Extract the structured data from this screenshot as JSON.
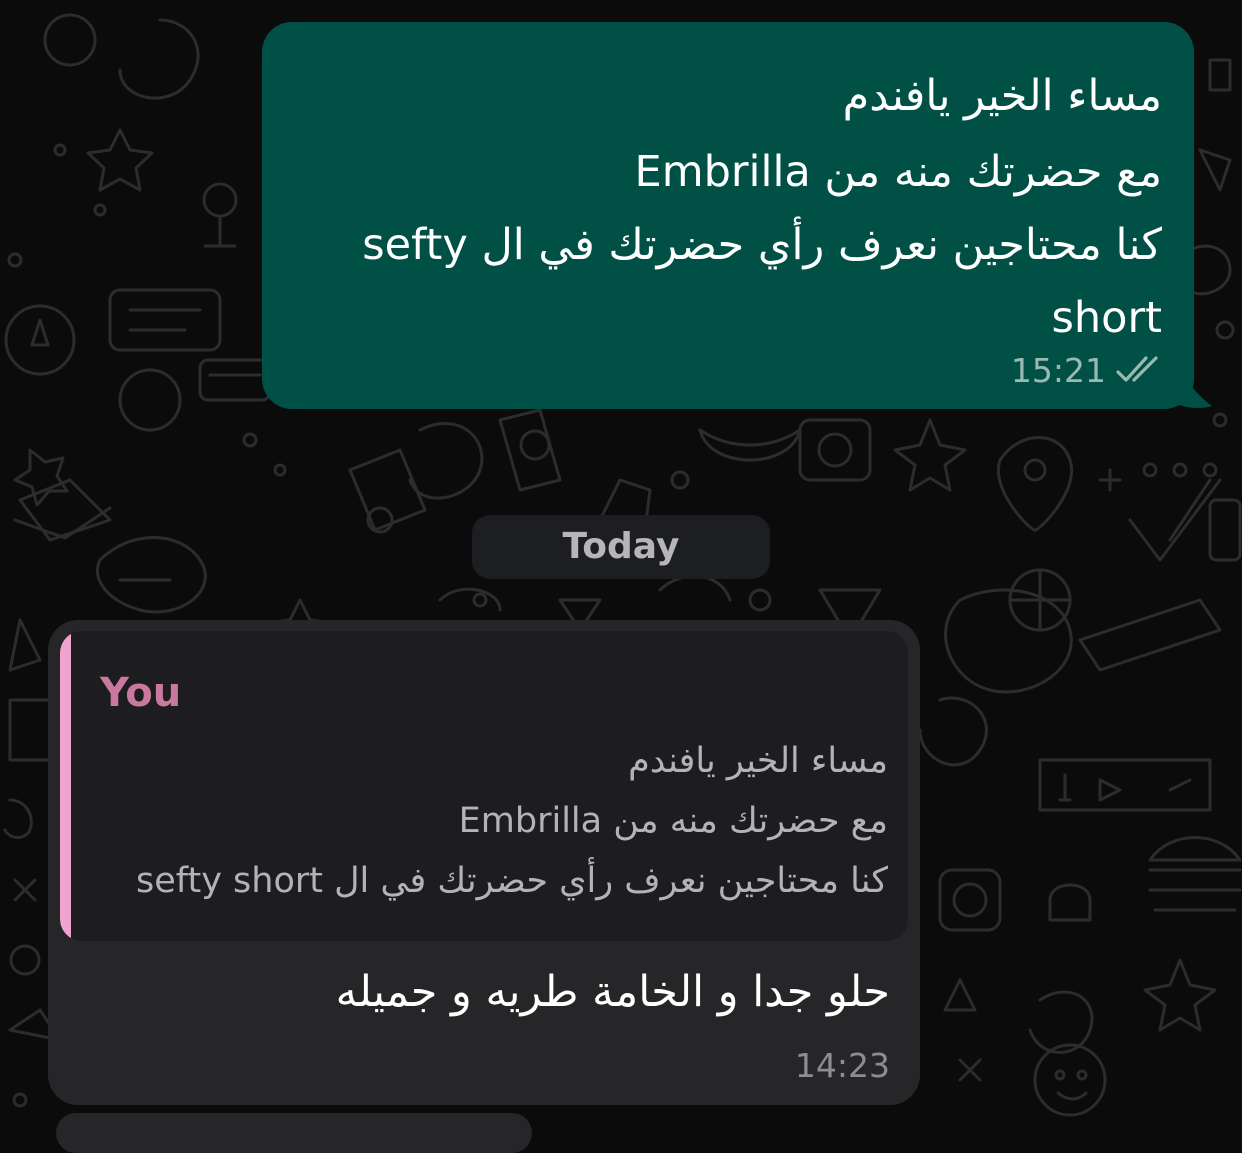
{
  "colors": {
    "outgoing_bubble": "#005046",
    "incoming_bubble": "#262628",
    "quote_background": "#1d1d1f",
    "quote_accent": "#f0a3cd",
    "quote_author": "#c9789f",
    "date_pill": "#1d1e21",
    "chat_background": "#0b0b0c"
  },
  "outgoing_message": {
    "lines": [
      "مساء الخير يافندم",
      "مع حضرتك منه من Embrilla",
      "كنا محتاجين نعرف رأي حضرتك في ال sefty",
      "short"
    ],
    "time": "15:21",
    "status_icon": "double-check-icon"
  },
  "date_separator": {
    "label": "Today"
  },
  "incoming_message": {
    "quoted": {
      "author": "You",
      "lines": [
        "مساء الخير يافندم",
        "مع حضرتك منه من Embrilla",
        "كنا محتاجين نعرف رأي حضرتك في ال sefty short"
      ]
    },
    "text": "حلو جدا و الخامة طريه و جميله",
    "time": "14:23"
  }
}
